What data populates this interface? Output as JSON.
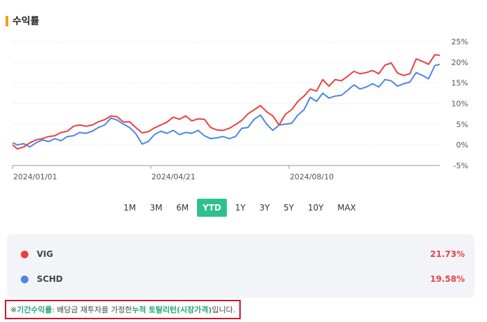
{
  "section": {
    "title": "수익률",
    "accent_color": "#f59a14"
  },
  "chart_data": {
    "type": "line",
    "x_start": "2024-01-01",
    "x_end": "2024-12-09",
    "x_tick_labels": [
      "2024/01/01",
      "2024/04/21",
      "2024/08/10"
    ],
    "x_ticks": [
      "2024-01-01",
      "2024-04-21",
      "2024-08-10"
    ],
    "y_ticks": [
      25,
      20,
      15,
      10,
      5,
      0,
      -5
    ],
    "y_tick_labels": [
      "25%",
      "20%",
      "15%",
      "10%",
      "5%",
      "0%",
      "-5%"
    ],
    "ylim": [
      -5,
      25
    ],
    "grid": true,
    "series": [
      {
        "name": "VIG",
        "color": "#e8403f",
        "x": [
          "2024-01-01",
          "2024-01-05",
          "2024-01-10",
          "2024-01-15",
          "2024-01-20",
          "2024-01-25",
          "2024-01-30",
          "2024-02-04",
          "2024-02-09",
          "2024-02-14",
          "2024-02-19",
          "2024-02-24",
          "2024-02-29",
          "2024-03-05",
          "2024-03-10",
          "2024-03-15",
          "2024-03-20",
          "2024-03-25",
          "2024-03-30",
          "2024-04-04",
          "2024-04-09",
          "2024-04-14",
          "2024-04-19",
          "2024-04-24",
          "2024-04-29",
          "2024-05-04",
          "2024-05-09",
          "2024-05-14",
          "2024-05-19",
          "2024-05-24",
          "2024-05-29",
          "2024-06-03",
          "2024-06-08",
          "2024-06-13",
          "2024-06-18",
          "2024-06-23",
          "2024-06-28",
          "2024-07-03",
          "2024-07-08",
          "2024-07-13",
          "2024-07-18",
          "2024-07-23",
          "2024-07-28",
          "2024-08-02",
          "2024-08-07",
          "2024-08-12",
          "2024-08-17",
          "2024-08-22",
          "2024-08-27",
          "2024-09-01",
          "2024-09-06",
          "2024-09-11",
          "2024-09-16",
          "2024-09-21",
          "2024-09-26",
          "2024-10-01",
          "2024-10-06",
          "2024-10-11",
          "2024-10-16",
          "2024-10-21",
          "2024-10-26",
          "2024-10-31",
          "2024-11-05",
          "2024-11-10",
          "2024-11-15",
          "2024-11-20",
          "2024-11-25",
          "2024-11-30",
          "2024-12-05",
          "2024-12-09"
        ],
        "values": [
          0.0,
          -1.0,
          -0.5,
          0.5,
          1.2,
          1.5,
          2.0,
          2.2,
          3.0,
          3.3,
          4.5,
          4.8,
          4.5,
          4.8,
          5.6,
          6.1,
          7.0,
          6.8,
          5.5,
          5.6,
          4.2,
          2.9,
          3.2,
          4.1,
          4.8,
          5.5,
          6.7,
          6.2,
          7.0,
          5.8,
          6.3,
          6.2,
          4.2,
          3.6,
          3.5,
          4.0,
          4.9,
          5.9,
          7.5,
          8.5,
          9.5,
          8.0,
          7.0,
          4.8,
          7.4,
          8.5,
          10.5,
          11.8,
          13.5,
          13.0,
          15.8,
          14.2,
          15.8,
          15.5,
          16.6,
          17.8,
          17.2,
          17.5,
          18.0,
          17.2,
          19.3,
          19.8,
          17.4,
          16.8,
          17.2,
          20.8,
          20.2,
          19.5,
          21.8,
          21.7
        ]
      },
      {
        "name": "SCHD",
        "color": "#4a86e8",
        "x": [
          "2024-01-01",
          "2024-01-05",
          "2024-01-10",
          "2024-01-15",
          "2024-01-20",
          "2024-01-25",
          "2024-01-30",
          "2024-02-04",
          "2024-02-09",
          "2024-02-14",
          "2024-02-19",
          "2024-02-24",
          "2024-02-29",
          "2024-03-05",
          "2024-03-10",
          "2024-03-15",
          "2024-03-20",
          "2024-03-25",
          "2024-03-30",
          "2024-04-04",
          "2024-04-09",
          "2024-04-14",
          "2024-04-19",
          "2024-04-24",
          "2024-04-29",
          "2024-05-04",
          "2024-05-09",
          "2024-05-14",
          "2024-05-19",
          "2024-05-24",
          "2024-05-29",
          "2024-06-03",
          "2024-06-08",
          "2024-06-13",
          "2024-06-18",
          "2024-06-23",
          "2024-06-28",
          "2024-07-03",
          "2024-07-08",
          "2024-07-13",
          "2024-07-18",
          "2024-07-23",
          "2024-07-28",
          "2024-08-02",
          "2024-08-07",
          "2024-08-12",
          "2024-08-17",
          "2024-08-22",
          "2024-08-27",
          "2024-09-01",
          "2024-09-06",
          "2024-09-11",
          "2024-09-16",
          "2024-09-21",
          "2024-09-26",
          "2024-10-01",
          "2024-10-06",
          "2024-10-11",
          "2024-10-16",
          "2024-10-21",
          "2024-10-26",
          "2024-10-31",
          "2024-11-05",
          "2024-11-10",
          "2024-11-15",
          "2024-11-20",
          "2024-11-25",
          "2024-11-30",
          "2024-12-05",
          "2024-12-09"
        ],
        "values": [
          0.5,
          0.0,
          0.3,
          -0.5,
          0.5,
          1.2,
          0.8,
          1.5,
          1.0,
          2.0,
          2.2,
          3.0,
          2.8,
          3.3,
          4.2,
          4.8,
          6.5,
          6.0,
          5.0,
          4.2,
          2.7,
          0.2,
          0.8,
          2.5,
          3.3,
          2.8,
          3.5,
          2.5,
          3.0,
          2.8,
          3.5,
          2.2,
          1.5,
          1.7,
          2.0,
          1.5,
          2.0,
          4.0,
          4.2,
          6.2,
          7.2,
          5.0,
          3.5,
          4.8,
          5.0,
          5.2,
          7.2,
          8.5,
          11.5,
          10.5,
          12.5,
          11.3,
          11.8,
          12.0,
          13.2,
          14.5,
          13.5,
          14.0,
          14.8,
          14.0,
          15.8,
          15.5,
          14.2,
          14.8,
          15.2,
          17.5,
          16.8,
          16.0,
          19.2,
          19.5
        ]
      }
    ]
  },
  "periods": {
    "items": [
      "1M",
      "3M",
      "6M",
      "YTD",
      "1Y",
      "3Y",
      "5Y",
      "10Y",
      "MAX"
    ],
    "active": "YTD"
  },
  "legend": [
    {
      "name": "VIG",
      "value": "21.73%",
      "color": "#e8403f"
    },
    {
      "name": "SCHD",
      "value": "19.58%",
      "color": "#4a86e8"
    }
  ],
  "note": {
    "prefix": "※ ",
    "highlight1": "기간수익률",
    "middle": " : 배당금 재투자를 가정한 ",
    "highlight2": "누적 토탈리턴(시장가격)",
    "suffix": "입니다."
  }
}
